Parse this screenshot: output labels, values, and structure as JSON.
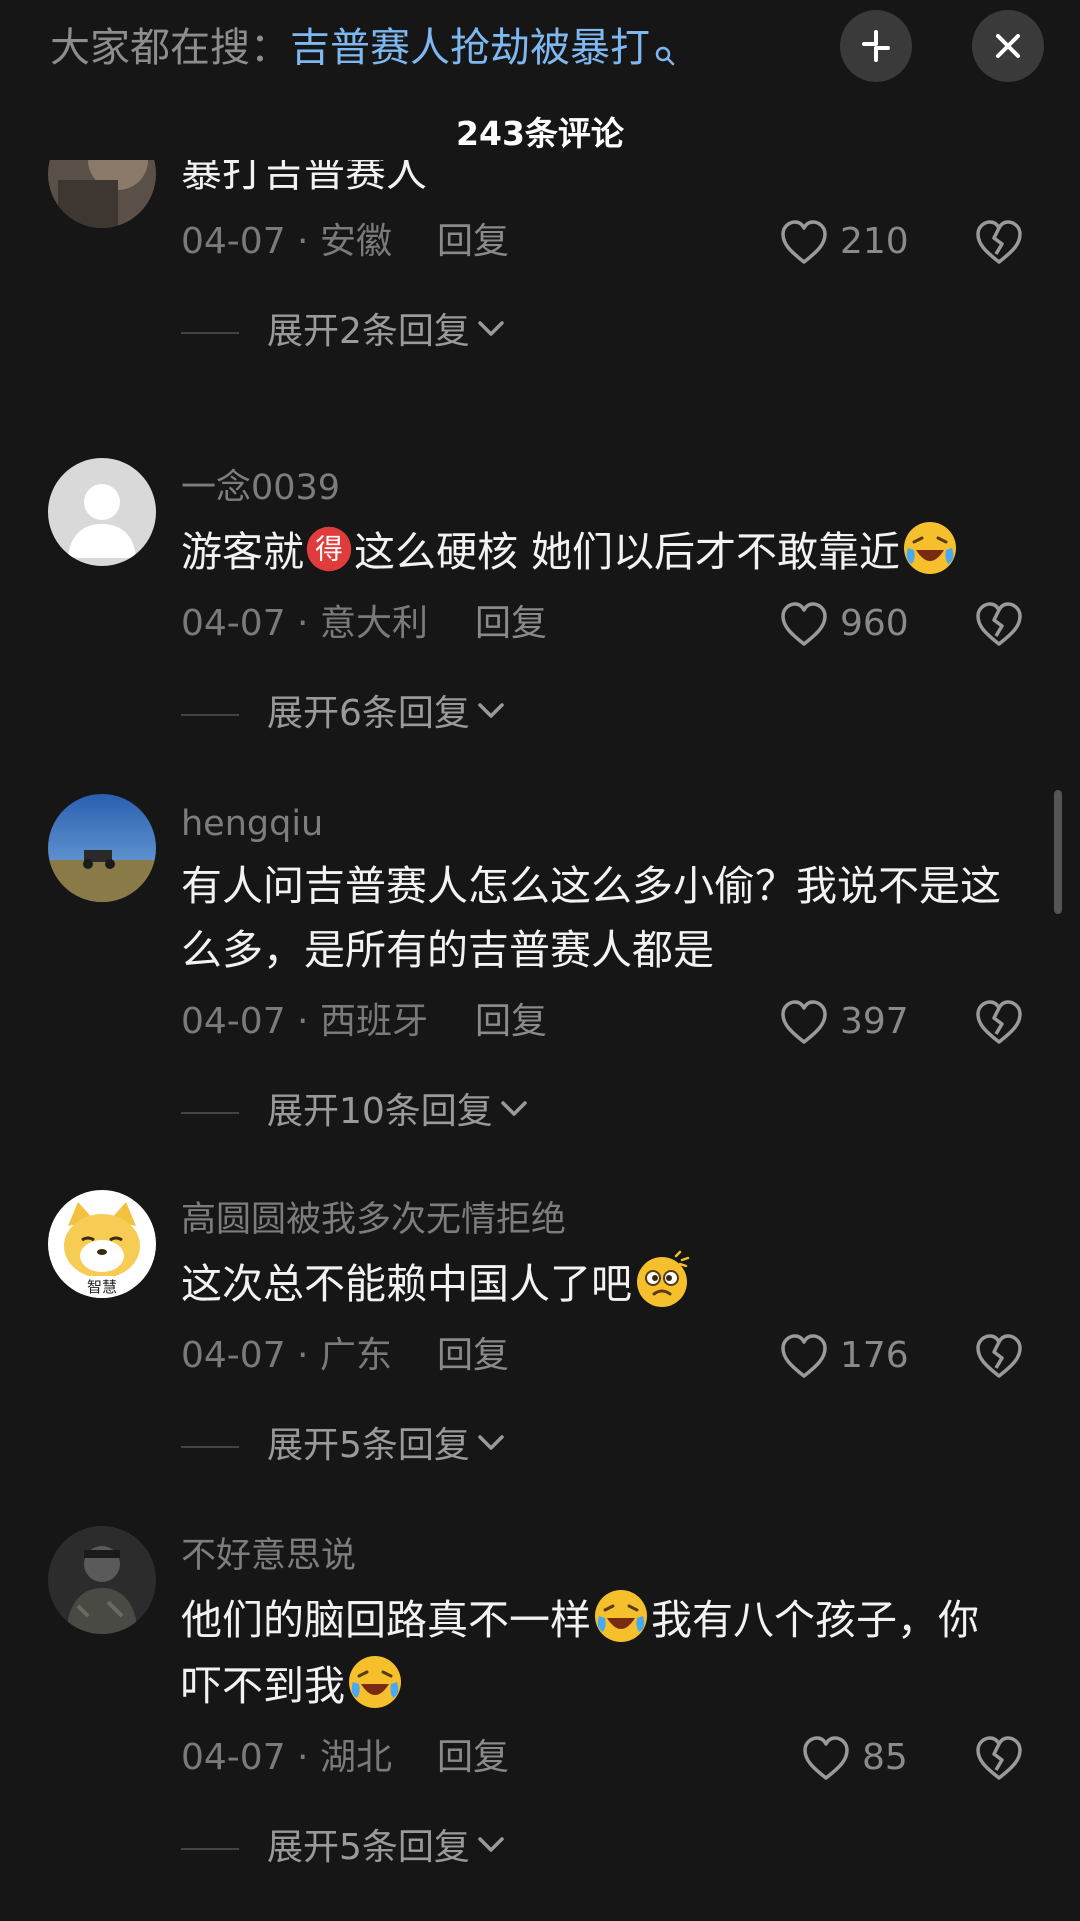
{
  "header": {
    "search_prefix": "大家都在搜：",
    "search_term": "吉普赛人抢劫被暴打",
    "comment_count": "243条评论"
  },
  "comments": [
    {
      "username": "",
      "text": "暴打吉普赛人",
      "date_location": "04-07 · 安徽",
      "reply_label": "回复",
      "likes": "210",
      "expand_label": "展开2条回复"
    },
    {
      "username": "一念0039",
      "text_parts": [
        "游客就",
        "这么硬核 她们以后才不敢靠近"
      ],
      "inline_badge": "得",
      "date_location": "04-07 · 意大利",
      "reply_label": "回复",
      "likes": "960",
      "expand_label": "展开6条回复"
    },
    {
      "username": "hengqiu",
      "text": "有人问吉普赛人怎么这么多小偷？我说不是这么多，是所有的吉普赛人都是",
      "date_location": "04-07 · 西班牙",
      "reply_label": "回复",
      "likes": "397",
      "expand_label": "展开10条回复"
    },
    {
      "username": "高圆圆被我多次无情拒绝",
      "text": "这次总不能赖中国人了吧",
      "avatar_badge": "智慧",
      "date_location": "04-07 · 广东",
      "reply_label": "回复",
      "likes": "176",
      "expand_label": "展开5条回复"
    },
    {
      "username": "不好意思说",
      "text_parts": [
        "他们的脑回路真不一样",
        "我有八个孩子，你吓不到我"
      ],
      "date_location": "04-07 · 湖北",
      "reply_label": "回复",
      "likes": "85",
      "expand_label": "展开5条回复"
    }
  ],
  "icons": {
    "search_hint": "search-icon",
    "collapse": "collapse-icon",
    "close": "close-icon",
    "like": "heart-outline-icon",
    "dislike": "broken-heart-icon",
    "expand": "chevron-down-icon",
    "emoji_laugh": "laughing-crying-emoji-icon",
    "emoji_dizzy": "dizzy-face-emoji-icon"
  },
  "colors": {
    "background": "#161616",
    "search_term": "#7fb8f0",
    "badge_red": "#e03c3c"
  }
}
